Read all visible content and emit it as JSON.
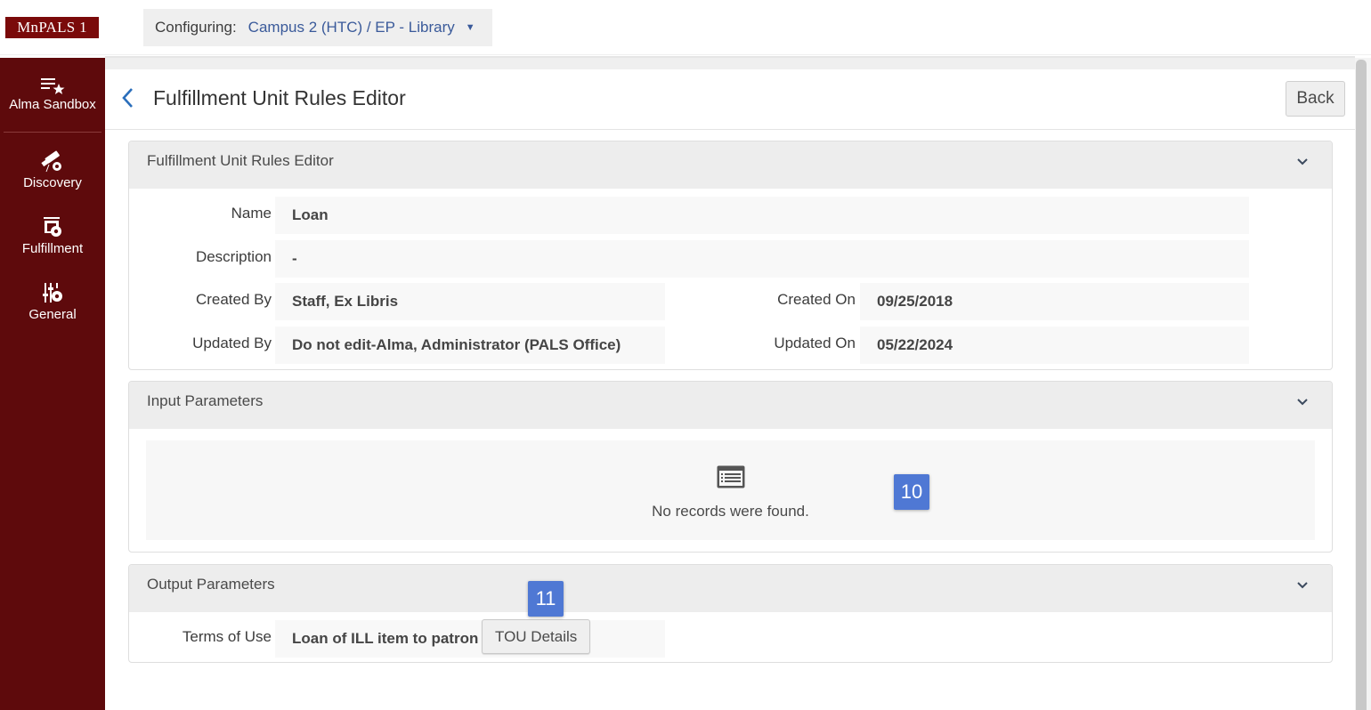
{
  "topbar": {
    "logo": "MnPALS 1",
    "configuring_label": "Configuring:",
    "configuring_value": "Campus 2 (HTC) / EP - Library",
    "dropdown_icon": "caret-down-icon"
  },
  "sidebar": {
    "items": [
      {
        "label": "Alma Sandbox",
        "icon": "list-star-icon"
      },
      {
        "label": "Discovery",
        "icon": "telescope-gear-icon"
      },
      {
        "label": "Fulfillment",
        "icon": "fulfillment-gear-icon"
      },
      {
        "label": "General",
        "icon": "sliders-gear-icon"
      }
    ]
  },
  "header": {
    "title": "Fulfillment Unit Rules Editor",
    "back_label": "Back"
  },
  "details_panel": {
    "title": "Fulfillment Unit Rules Editor",
    "fields": {
      "name_label": "Name",
      "name_value": "Loan",
      "description_label": "Description",
      "description_value": "-",
      "created_by_label": "Created By",
      "created_by_value": "Staff, Ex Libris",
      "created_on_label": "Created On",
      "created_on_value": "09/25/2018",
      "updated_by_label": "Updated By",
      "updated_by_value": "Do not edit-Alma, Administrator (PALS Office)",
      "updated_on_label": "Updated On",
      "updated_on_value": "05/22/2024"
    }
  },
  "input_panel": {
    "title": "Input Parameters",
    "empty_message": "No records were found."
  },
  "output_panel": {
    "title": "Output Parameters",
    "terms_label": "Terms of Use",
    "terms_value": "Loan of ILL item to patron",
    "tou_button": "TOU Details"
  },
  "markers": {
    "m10": "10",
    "m11": "11"
  },
  "colors": {
    "sidebar": "#5e0a0c",
    "logo_bg": "#7a0a0a",
    "link": "#3a5a9a",
    "marker": "#4f78d4"
  }
}
